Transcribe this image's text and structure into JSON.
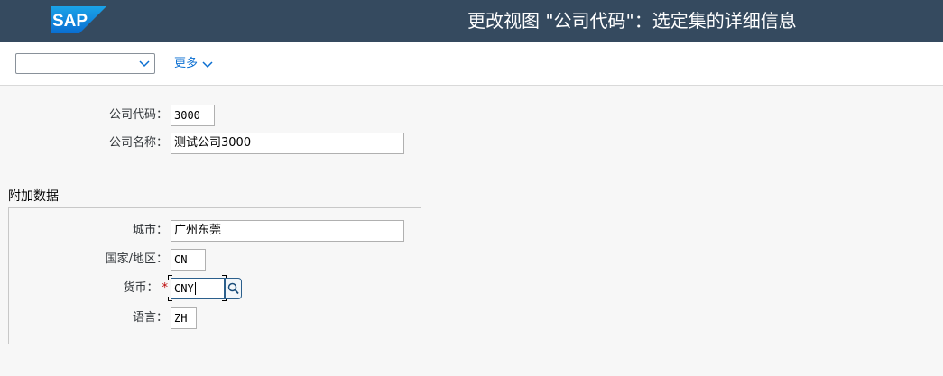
{
  "shell": {
    "logo_text": "SAP",
    "title": "更改视图 \"公司代码\"：选定集的详细信息",
    "brand_color": "#354a5f",
    "logo_color": "#0a7fc7"
  },
  "toolbar": {
    "variant_value": "",
    "more_label": "更多"
  },
  "header_fields": {
    "company_code_label": "公司代码：",
    "company_code_value": "3000",
    "company_name_label": "公司名称：",
    "company_name_value": "测试公司3000"
  },
  "additional": {
    "title": "附加数据",
    "city_label": "城市：",
    "city_value": "广州东莞",
    "country_label": "国家/地区：",
    "country_value": "CN",
    "currency_label": "货币：",
    "currency_required": "*",
    "currency_value": "CNY",
    "language_label": "语言：",
    "language_value": "ZH"
  },
  "icons": {
    "logo": "sap-logo",
    "variant_dropdown": "chevron-down-icon",
    "more": "chevron-down-icon",
    "value_help": "search-icon"
  }
}
